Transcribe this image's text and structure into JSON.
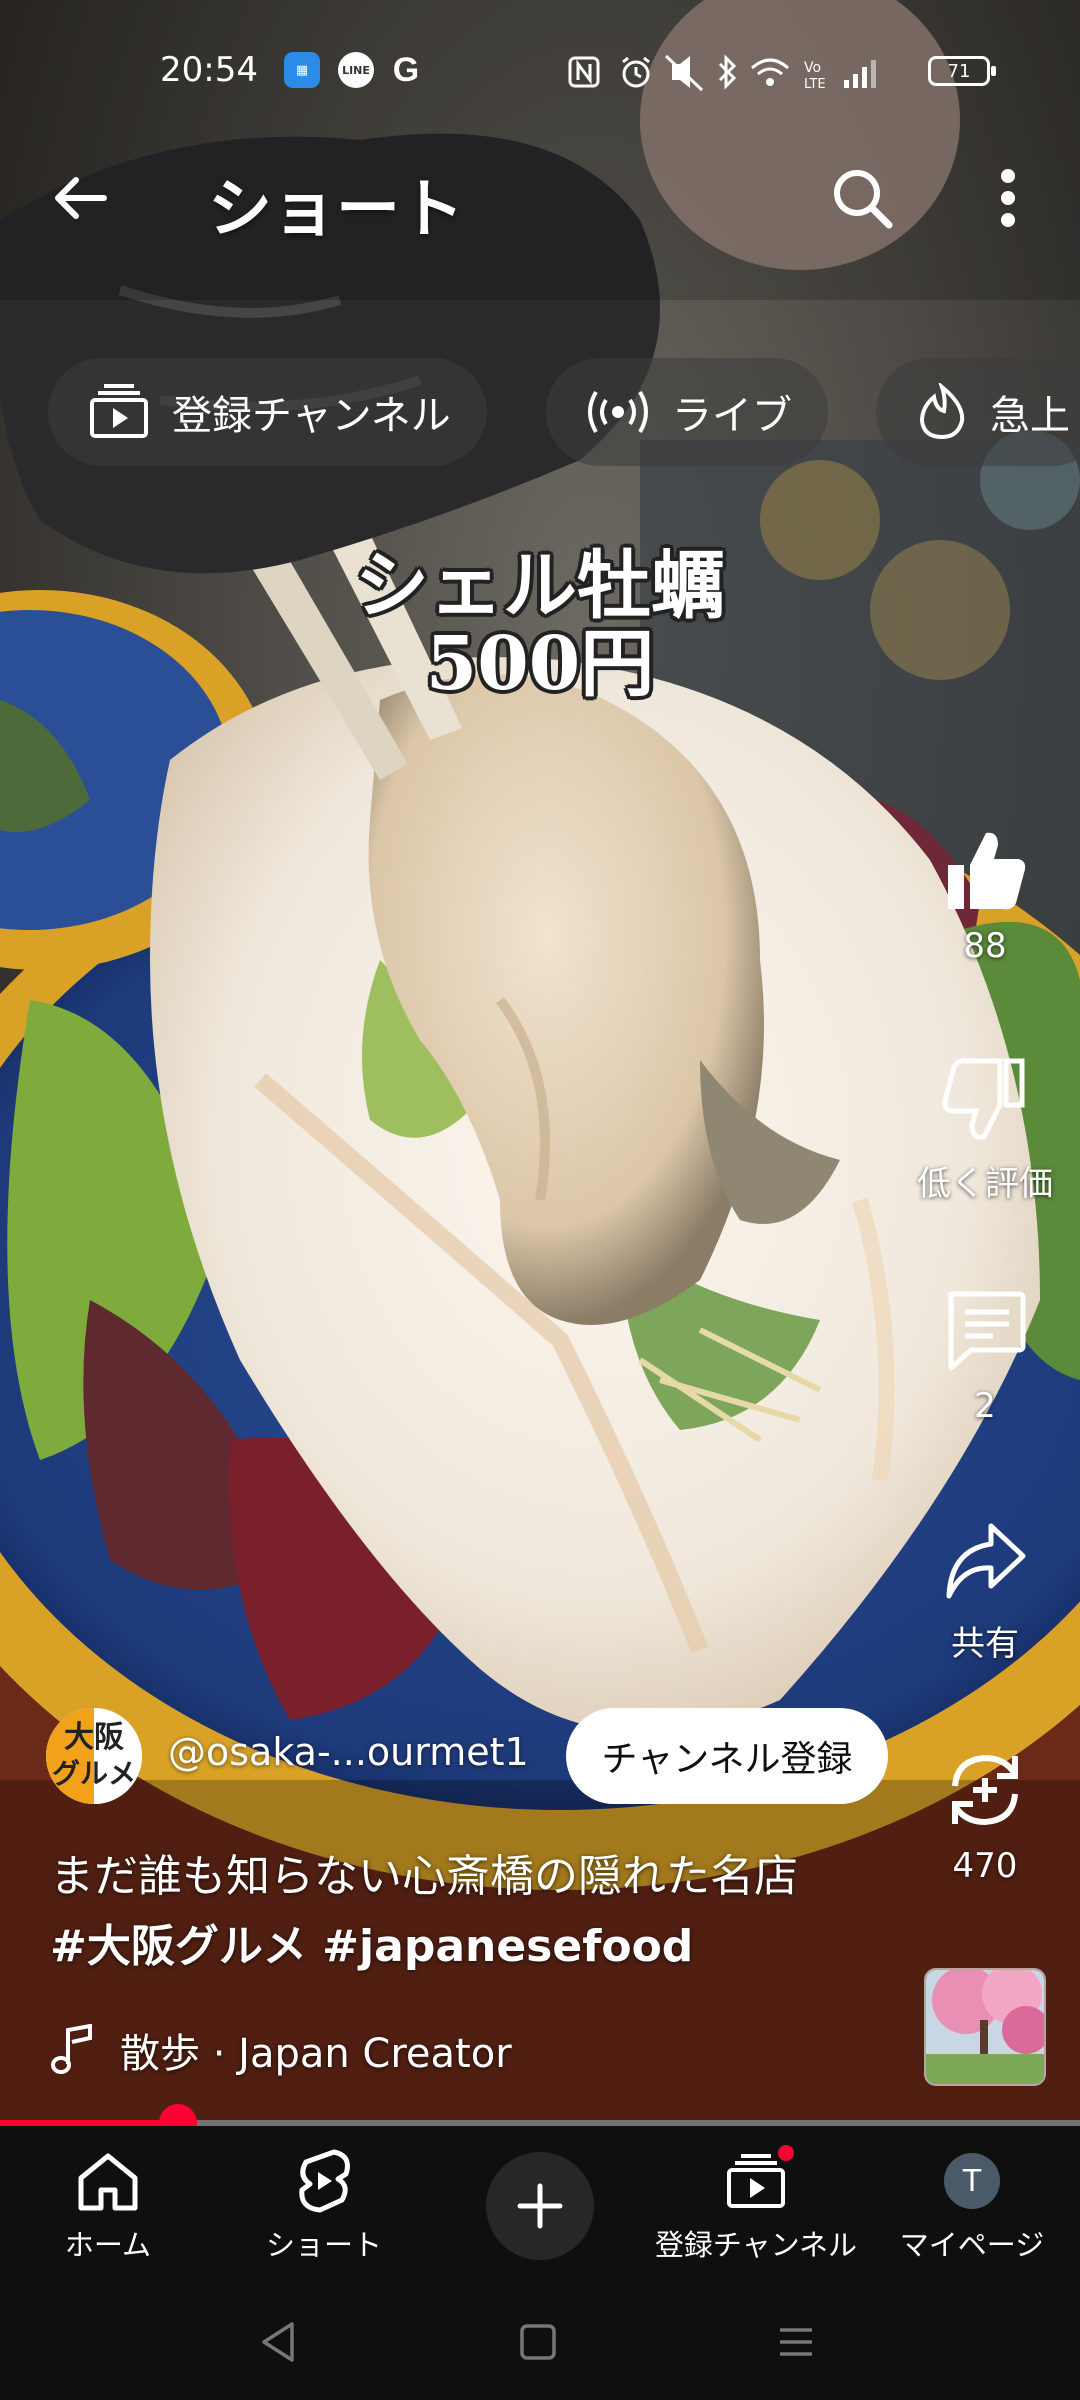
{
  "status_bar": {
    "time": "20:54",
    "notification_icons": [
      "jp-app-icon",
      "line-icon",
      "google-icon"
    ],
    "system_icons": [
      "nfc-icon",
      "alarm-icon",
      "mute-icon",
      "bluetooth-icon",
      "wifi-icon",
      "volte-icon",
      "signal-icon"
    ],
    "battery": "71"
  },
  "app_bar": {
    "title": "ショート",
    "back_icon": "arrow-left-icon",
    "search_icon": "search-icon",
    "more_icon": "more-vert-icon"
  },
  "chips": [
    {
      "label": "登録チャンネル",
      "icon": "subscriptions-icon"
    },
    {
      "label": "ライブ",
      "icon": "live-icon"
    },
    {
      "label": "急上",
      "icon": "trending-icon"
    }
  ],
  "video": {
    "caption_line1": "シェル牡蠣",
    "caption_line2": "500円"
  },
  "actions": {
    "like_count": "88",
    "dislike_label": "低く評価",
    "comment_count": "2",
    "share_label": "共有",
    "remix_count": "470"
  },
  "channel": {
    "avatar_text_1": "大阪",
    "avatar_text_2": "グルメ",
    "handle": "@osaka-...ourmet1",
    "subscribe_label": "チャンネル登録"
  },
  "title": {
    "text": "まだ誰も知らない心斎橋の隠れた名店",
    "hashtags": "#大阪グルメ #japanesefood"
  },
  "music": {
    "text": "散歩 · Japan Creator"
  },
  "progress": {
    "fraction": 0.165
  },
  "bottom_nav": [
    {
      "label": "ホーム",
      "icon": "home-icon"
    },
    {
      "label": "ショート",
      "icon": "shorts-icon"
    },
    {
      "label": "",
      "icon": "plus-icon"
    },
    {
      "label": "登録チャンネル",
      "icon": "subscriptions-icon"
    },
    {
      "label": "マイページ",
      "icon": "avatar",
      "avatar_letter": "T"
    }
  ],
  "colors": {
    "accent": "#ff0033",
    "nav_bg": "#0f0f0f",
    "chip_bg": "#3c3c3c"
  }
}
